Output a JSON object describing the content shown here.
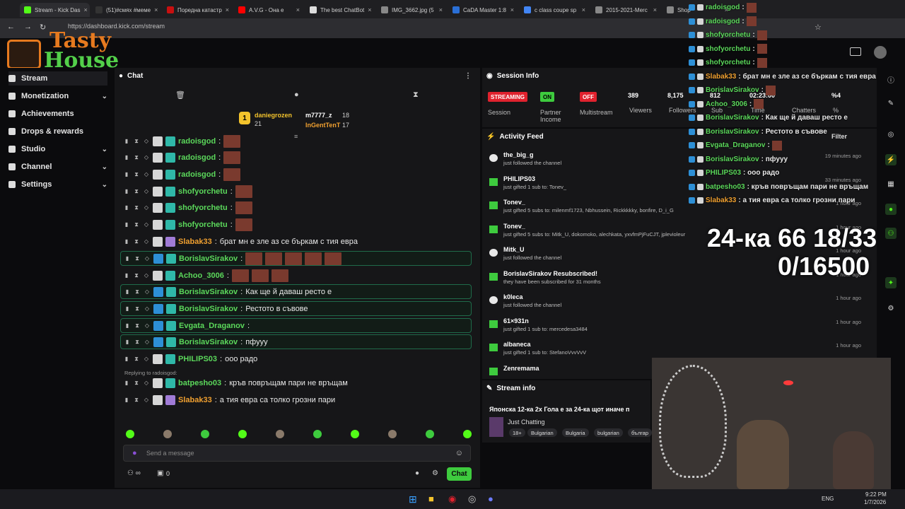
{
  "browser": {
    "tabs": [
      {
        "label": "Stream - Kick Das",
        "color": "#53fc18"
      },
      {
        "label": "(51)#смях #меме",
        "color": "#333"
      },
      {
        "label": "Поредна катастр",
        "color": "#c81010"
      },
      {
        "label": "A.V.G - Она е",
        "color": "#ff0000"
      },
      {
        "label": "The best ChatBot",
        "color": "#ddd"
      },
      {
        "label": "IMG_3662.jpg (5",
        "color": "#888"
      },
      {
        "label": "CaDA Master 1:8",
        "color": "#2a6fd6"
      },
      {
        "label": "c class coupe sp",
        "color": "#4285f4"
      },
      {
        "label": "2015-2021-Merc",
        "color": "#888"
      },
      {
        "label": "Shop",
        "color": "#888"
      }
    ],
    "url": "https://dashboard.kick.com/stream",
    "overlay_tab_right": "nversion Body"
  },
  "logo": {
    "line1": "Tasty",
    "line2": "House"
  },
  "sidebar": {
    "items": [
      {
        "label": "Stream",
        "icon": "video-icon",
        "chevron": ""
      },
      {
        "label": "Monetization",
        "icon": "money-icon",
        "chevron": "⌄"
      },
      {
        "label": "Achievements",
        "icon": "trophy-icon",
        "chevron": ""
      },
      {
        "label": "Drops & rewards",
        "icon": "gift-icon",
        "chevron": ""
      },
      {
        "label": "Studio",
        "icon": "gear-icon",
        "chevron": "⌄"
      },
      {
        "label": "Channel",
        "icon": "user-icon",
        "chevron": "⌄"
      },
      {
        "label": "Settings",
        "icon": "settings-icon",
        "chevron": "⌄"
      }
    ]
  },
  "chat": {
    "title": "Chat",
    "leaderboard": [
      {
        "rank": "1",
        "name": "daniegrozen",
        "count": "21"
      },
      {
        "name": "m7777_z",
        "count": "18"
      },
      {
        "name": "InGentTenT",
        "count": "17"
      }
    ],
    "messages": [
      {
        "user": "radoisgod",
        "text": "",
        "color": "#5bd85b",
        "emotes": 1,
        "hl": false
      },
      {
        "user": "radoisgod",
        "text": "",
        "color": "#5bd85b",
        "emotes": 1,
        "hl": false
      },
      {
        "user": "radoisgod",
        "text": "",
        "color": "#5bd85b",
        "emotes": 1,
        "hl": false
      },
      {
        "user": "shofyorchetu",
        "text": "",
        "color": "#5bd85b",
        "emotes": 1,
        "hl": false
      },
      {
        "user": "shofyorchetu",
        "text": "",
        "color": "#5bd85b",
        "emotes": 1,
        "hl": false
      },
      {
        "user": "shofyorchetu",
        "text": "",
        "color": "#5bd85b",
        "emotes": 1,
        "hl": false
      },
      {
        "user": "Slabak33",
        "text": "брат мн е зле аз се бъркам с тия евра",
        "color": "#f0a030",
        "emotes": 0,
        "hl": false
      },
      {
        "user": "BorislavSirakov",
        "text": "",
        "color": "#5bd85b",
        "emotes": 5,
        "hl": true
      },
      {
        "user": "Achoo_3006",
        "text": "",
        "color": "#5bd85b",
        "emotes": 3,
        "hl": false
      },
      {
        "user": "BorislavSirakov",
        "text": "Как ще й даваш ресто е",
        "color": "#5bd85b",
        "emotes": 0,
        "hl": true
      },
      {
        "user": "BorislavSirakov",
        "text": "Рестото в съвове",
        "color": "#5bd85b",
        "emotes": 0,
        "hl": true
      },
      {
        "user": "Evgata_Draganov",
        "text": "",
        "color": "#5bd85b",
        "emotes": 0,
        "hl": true
      },
      {
        "user": "BorislavSirakov",
        "text": "пфууу",
        "color": "#5bd85b",
        "emotes": 0,
        "hl": true
      },
      {
        "user": "PHILIPS03",
        "text": "ооо радо",
        "color": "#5bd85b",
        "emotes": 0,
        "hl": false
      },
      {
        "user": "batpesho03",
        "text": "кръв повръщам пари не връщам",
        "color": "#5bd85b",
        "emotes": 0,
        "hl": false
      },
      {
        "user": "Slabak33",
        "text": "а тия евра са толко грозни пари",
        "color": "#f0a030",
        "emotes": 0,
        "hl": false
      }
    ],
    "reply_note": "Replying to radoisgod:",
    "send_placeholder": "Send a message",
    "counter": "0",
    "chat_button": "Chat"
  },
  "session": {
    "title": "Session Info",
    "pills": [
      {
        "label": "STREAMING",
        "color": "#e0222e",
        "caption": "Session"
      },
      {
        "label": "ON",
        "color": "#3ecb3e",
        "caption": "Partner Income"
      },
      {
        "label": "OFF",
        "color": "#e0222e",
        "caption": "Multistream"
      }
    ],
    "stats": [
      {
        "value": "389",
        "label": "Viewers"
      },
      {
        "value": "8,175",
        "label": "Followers"
      },
      {
        "value": "812",
        "label": "Sub"
      },
      {
        "value": "02:23:00",
        "label": "Time"
      },
      {
        "value": "",
        "label": "Chatters"
      },
      {
        "value": "%4",
        "label": "%"
      }
    ]
  },
  "activity": {
    "title": "Activity Feed",
    "filter": "Filter",
    "items": [
      {
        "name": "the_big_g",
        "desc": "just followed the channel",
        "time": "19 minutes ago",
        "type": "heart"
      },
      {
        "name": "PHILIPS03",
        "desc": "just gifted 1 sub to: Tonev_",
        "time": "33 minutes ago",
        "type": "gift"
      },
      {
        "name": "Tonev_",
        "desc": "just gifted 5 subs to: milenmf1723, Nbhussein, Rickkkkky, bonfire, D_i_G",
        "time": "1 hour ago",
        "type": "gift"
      },
      {
        "name": "Tonev_",
        "desc": "just gifted 5 subs to: Mitk_U, dokomoko, alechkata, yxvfmPjFuCJT, jplevioleur",
        "time": "1 hour ago",
        "type": "gift"
      },
      {
        "name": "Mitk_U",
        "desc": "just followed the channel",
        "time": "1 hour ago",
        "type": "heart"
      },
      {
        "name": "BorislavSirakov Resubscribed!",
        "desc": "they have been subscribed for 31 months",
        "time": "1 hour ago",
        "type": "star"
      },
      {
        "name": "k0leca",
        "desc": "just followed the channel",
        "time": "1 hour ago",
        "type": "heart"
      },
      {
        "name": "61×931n",
        "desc": "just gifted 1 sub to: mercedesa3484",
        "time": "1 hour ago",
        "type": "gift"
      },
      {
        "name": "albaneca",
        "desc": "just gifted 1 sub to: StefanoVvvVvV",
        "time": "1 hour ago",
        "type": "gift"
      },
      {
        "name": "Zenremama",
        "desc": "",
        "time": "",
        "type": "gift"
      }
    ]
  },
  "stream_info": {
    "title": "Stream info",
    "stream_title": "Японска 12-ка 2х Гола е за 24-ка щот иначе п",
    "category": "Just Chatting",
    "tags": [
      "18+",
      "Bulgarian",
      "Bulgaria",
      "bulgarian",
      "българ"
    ]
  },
  "overlay": {
    "chat": [
      {
        "user": "radoisgod",
        "text": ":",
        "color": "#5bd85b"
      },
      {
        "user": "radoisgod",
        "text": ":",
        "color": "#5bd85b"
      },
      {
        "user": "shofyorchetu",
        "text": ":",
        "color": "#5bd85b"
      },
      {
        "user": "shofyorchetu",
        "text": ":",
        "color": "#5bd85b"
      },
      {
        "user": "shofyorchetu",
        "text": ":",
        "color": "#5bd85b"
      },
      {
        "user": "Slabak33",
        "text": ": брат мн е зле аз се бъркам с тия евра",
        "color": "#f0a030"
      },
      {
        "user": "BorislavSirakov",
        "text": ":",
        "color": "#5bd85b"
      },
      {
        "user": "Achoo_3006",
        "text": ":",
        "color": "#5bd85b"
      },
      {
        "user": "BorislavSirakov",
        "text": ": Как ще й даваш ресто е",
        "color": "#5bd85b"
      },
      {
        "user": "BorislavSirakov",
        "text": ": Рестото в съвове",
        "color": "#5bd85b"
      },
      {
        "user": "Evgata_Draganov",
        "text": ":",
        "color": "#5bd85b"
      },
      {
        "user": "BorislavSirakov",
        "text": ": пфууу",
        "color": "#5bd85b"
      },
      {
        "user": "PHILIPS03",
        "text": ": ооо радо",
        "color": "#5bd85b"
      },
      {
        "user": "batpesho03",
        "text": ": кръв повръщам пари не връщам",
        "color": "#5bd85b"
      },
      {
        "user": "Slabak33",
        "text": ": а тия евра са толко грозни пари",
        "color": "#f0a030"
      }
    ],
    "big_line1": "24-ка 66 18/33",
    "big_line2": "0/16500"
  },
  "taskbar": {
    "lang": "ENG",
    "time": "9:22 PM",
    "date": "1/7/2026"
  },
  "colors": {
    "accent": "#53fc18",
    "red": "#e0222e",
    "panel": "#161618"
  }
}
